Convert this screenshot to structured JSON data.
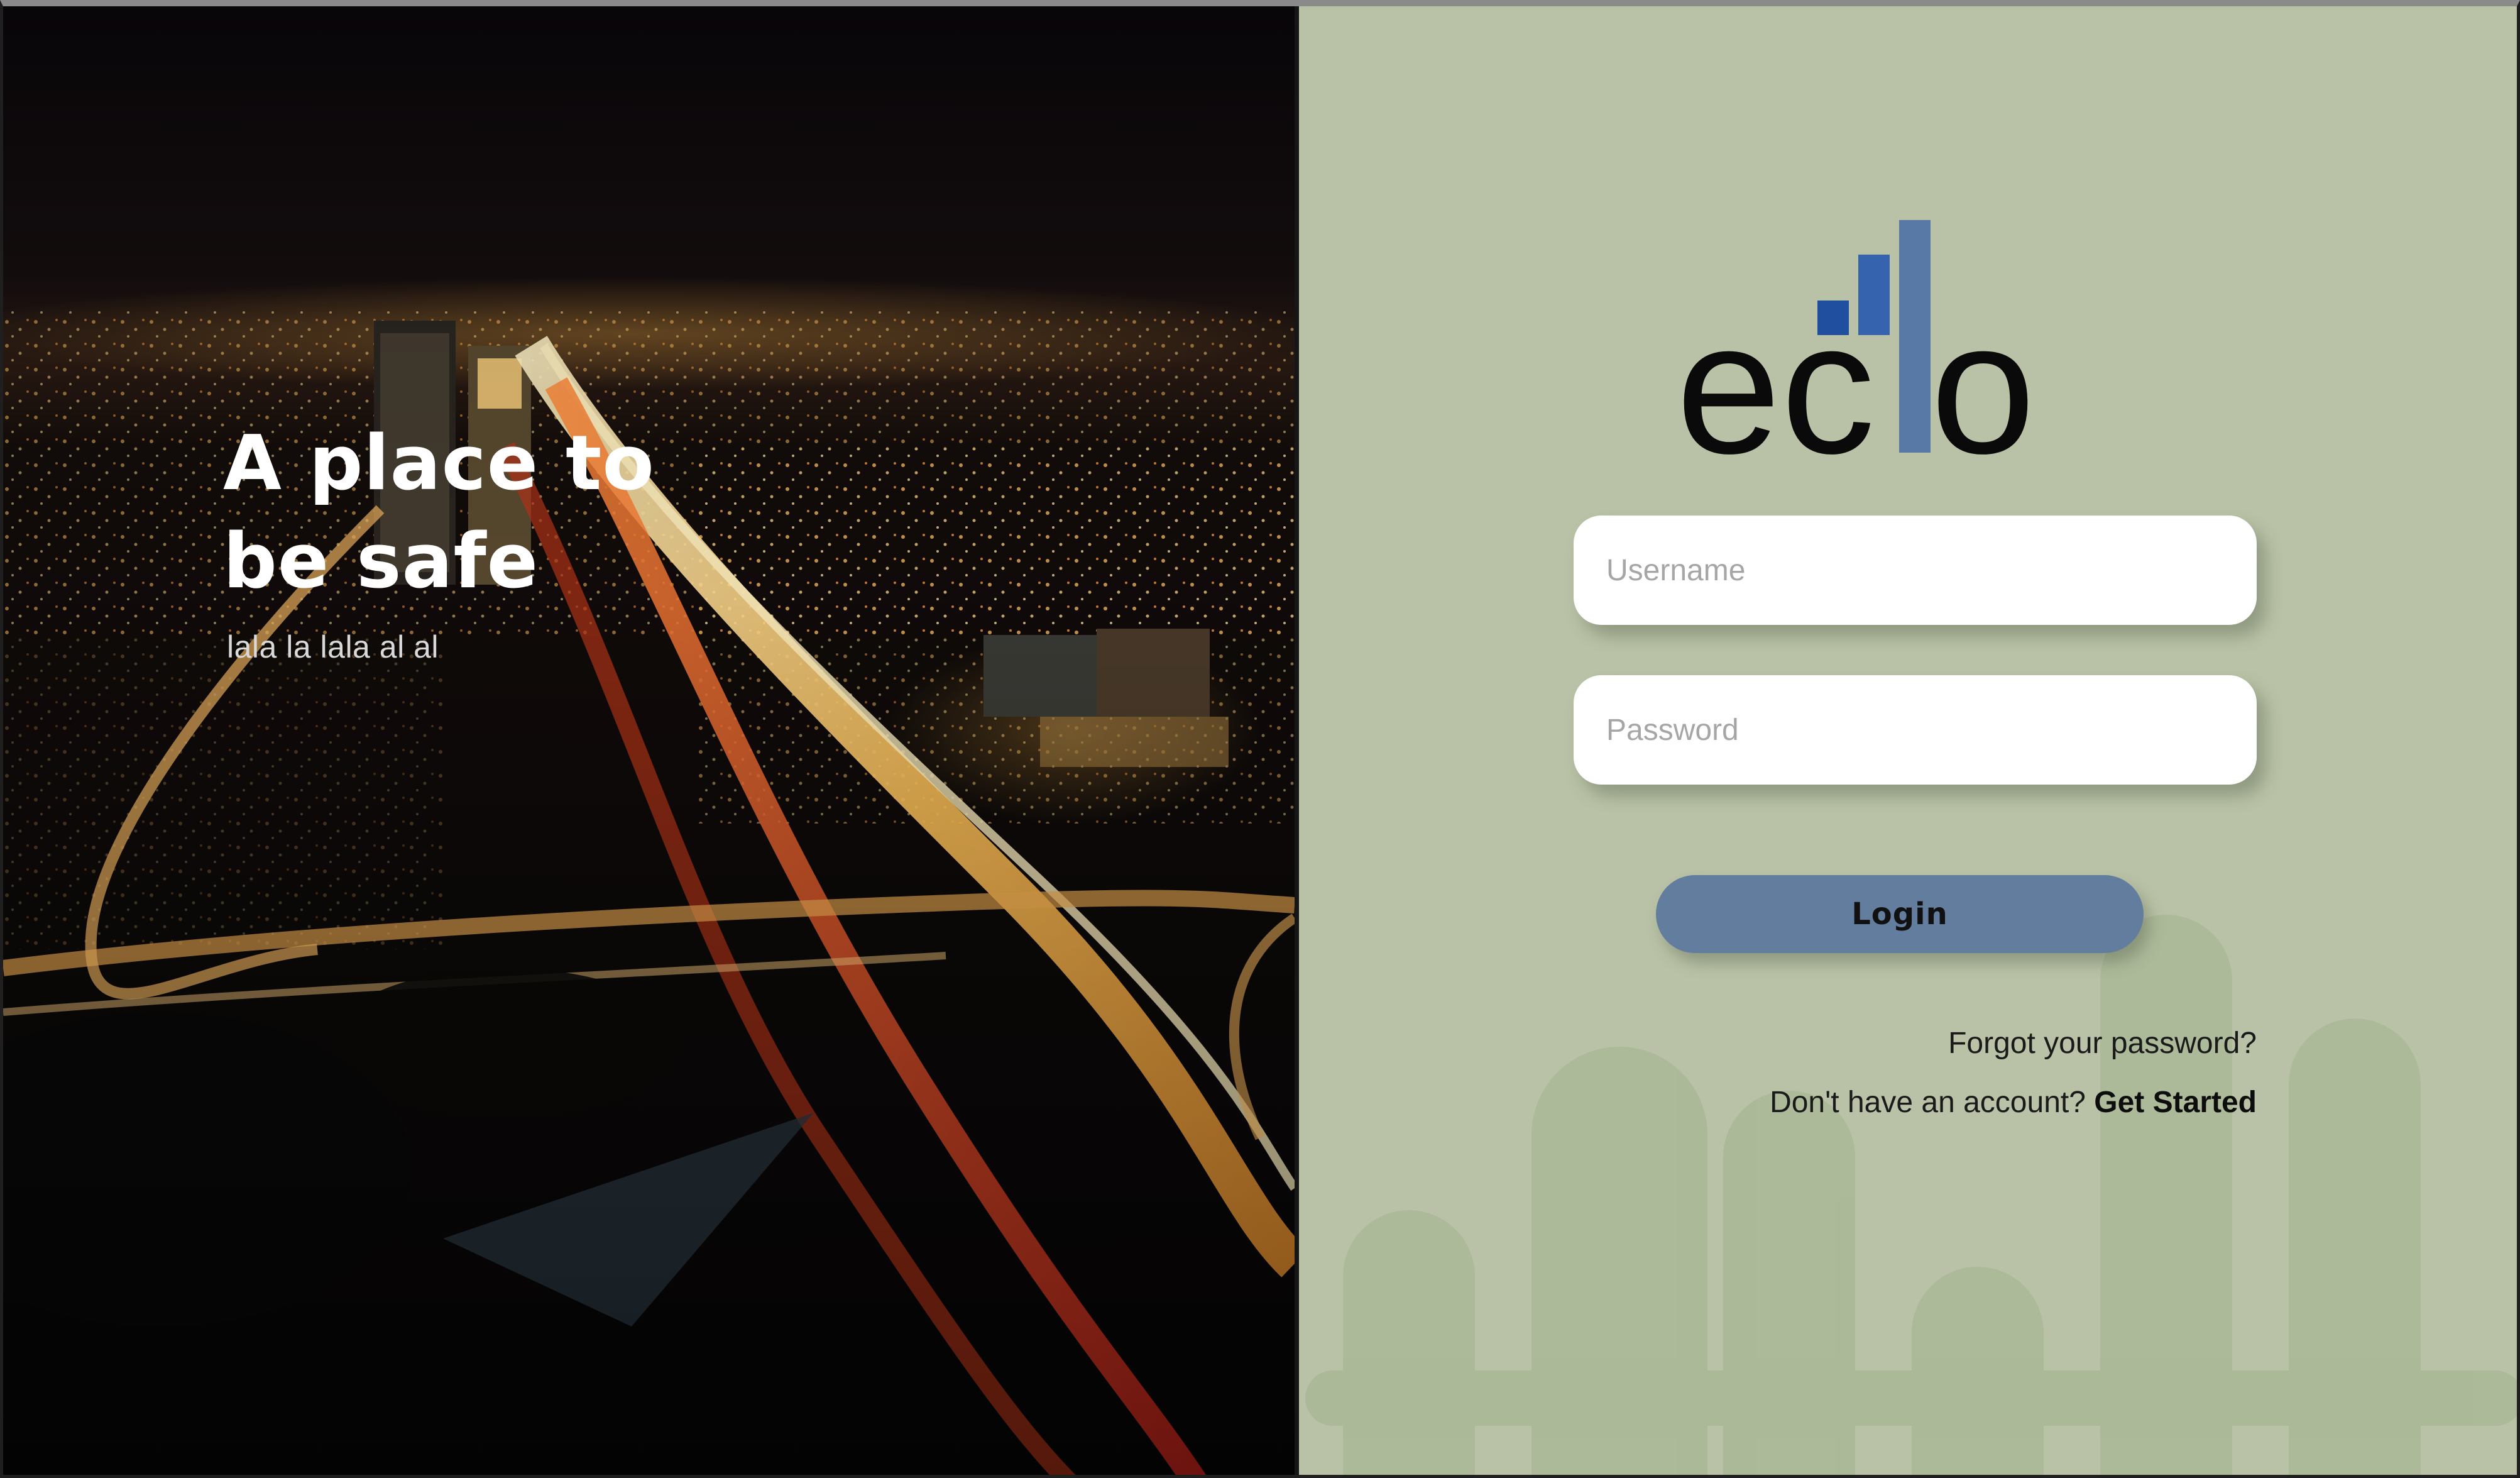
{
  "hero": {
    "title_line1": "A place to",
    "title_line2": "be safe",
    "subtitle": "lala la lala al al"
  },
  "brand": {
    "logo_text": "echo",
    "logo_bar_colors": [
      "#1f4f9e",
      "#3563ad",
      "#5878a6"
    ],
    "logo_text_color": "#0a0a0a"
  },
  "login_form": {
    "username_placeholder": "Username",
    "password_placeholder": "Password",
    "login_label": "Login",
    "forgot_password": "Forgot your password?",
    "no_account_prompt": "Don't have an account?",
    "get_started": "Get Started"
  },
  "colors": {
    "panel_background": "#b9c2a6",
    "button": "#637d9e",
    "fence": "#a9b79a"
  }
}
